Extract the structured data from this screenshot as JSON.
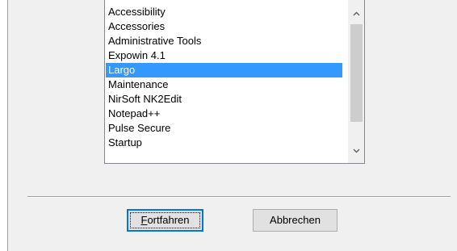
{
  "list": {
    "items": [
      "Accessibility",
      "Accessories",
      "Administrative Tools",
      "Expowin 4.1",
      "Largo",
      "Maintenance",
      "NirSoft NK2Edit",
      "Notepad++",
      "Pulse Secure",
      "Startup"
    ],
    "selected_index": 4
  },
  "scrollbar": {
    "up_icon": "chevron-up-icon",
    "down_icon": "chevron-down-icon"
  },
  "buttons": {
    "continue_mnemonic": "F",
    "continue_rest": "ortfahren",
    "cancel_label": "Abbrechen"
  },
  "colors": {
    "selection": "#3399ff",
    "dialog_bg": "#f0f0f0",
    "focus_border": "#0078d7"
  }
}
